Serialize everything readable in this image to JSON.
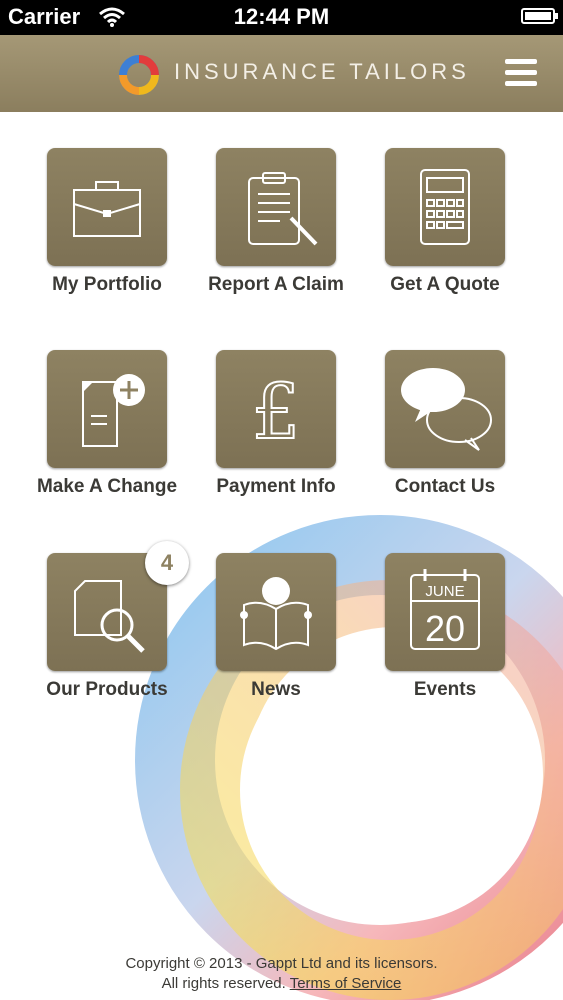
{
  "status_bar": {
    "carrier": "Carrier",
    "time": "12:44 PM"
  },
  "header": {
    "brand": "INSURANCE TAILORS",
    "menu_icon": "hamburger-menu-icon"
  },
  "tiles": [
    {
      "label": "My Portfolio",
      "icon": "briefcase-icon"
    },
    {
      "label": "Report A Claim",
      "icon": "clipboard-pen-icon"
    },
    {
      "label": "Get A Quote",
      "icon": "calculator-icon"
    },
    {
      "label": "Make A Change",
      "icon": "document-add-icon"
    },
    {
      "label": "Payment Info",
      "icon": "pound-sign-icon"
    },
    {
      "label": "Contact Us",
      "icon": "speech-bubbles-icon"
    },
    {
      "label": "Our Products",
      "icon": "document-search-icon",
      "badge": "4"
    },
    {
      "label": "News",
      "icon": "reader-icon"
    },
    {
      "label": "Events",
      "icon": "calendar-icon",
      "calendar_month": "JUNE",
      "calendar_day": "20"
    }
  ],
  "footer": {
    "copyright": "Copyright © 2013 - Gappt Ltd and its licensors.",
    "rights": "All rights reserved.",
    "terms_link": "Terms of Service"
  },
  "colors": {
    "tile": "#8e8262",
    "header": "#9b8e6c",
    "label_text": "#3b3a36"
  }
}
